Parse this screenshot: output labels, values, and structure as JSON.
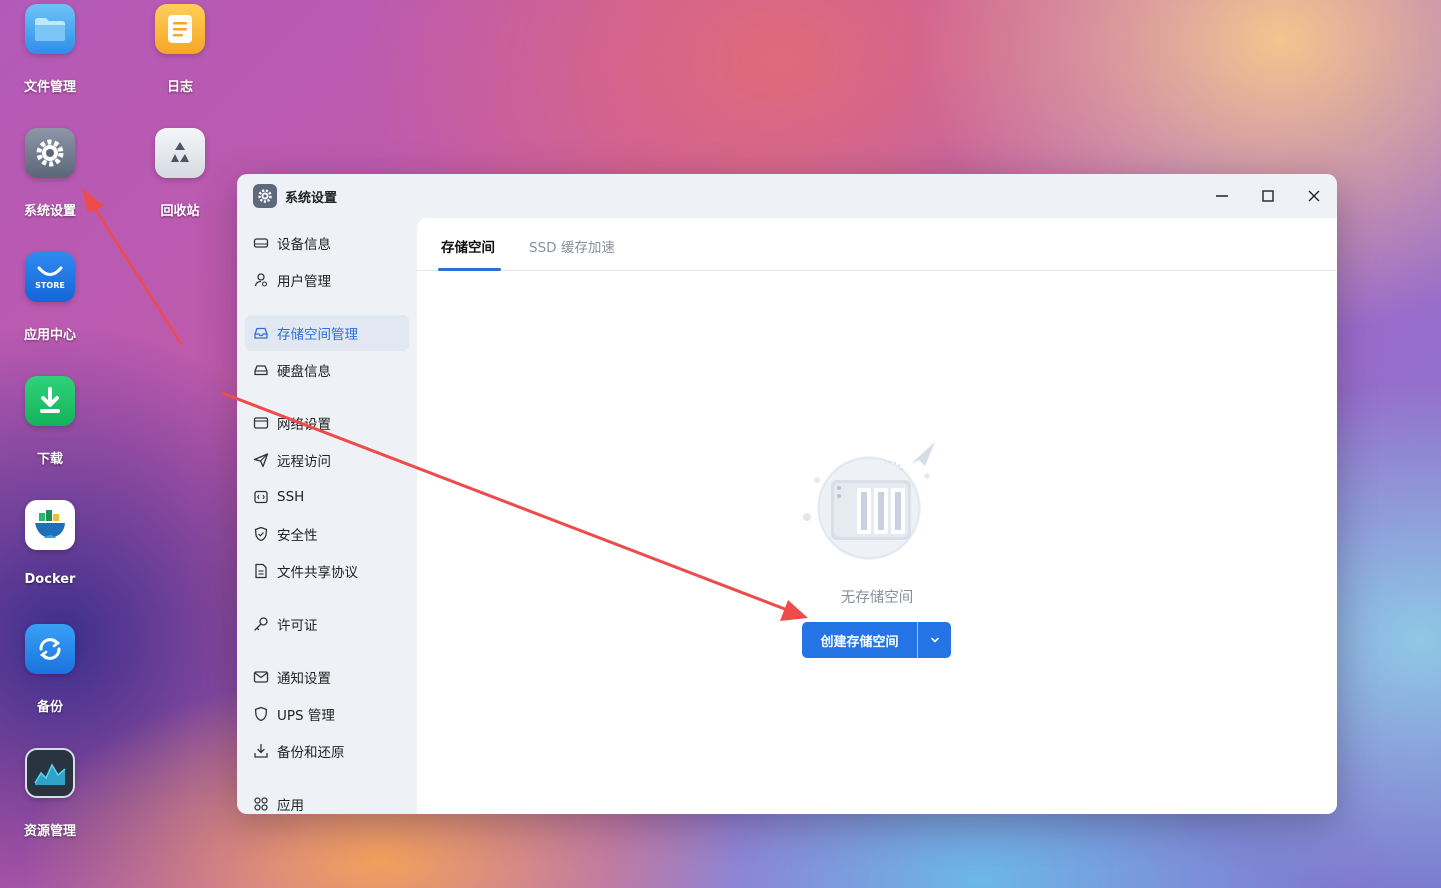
{
  "desktop": {
    "icons": [
      {
        "label": "文件管理"
      },
      {
        "label": "日志"
      },
      {
        "label": "系统设置"
      },
      {
        "label": "回收站"
      },
      {
        "label": "应用中心",
        "badge": "STORE"
      },
      {
        "label": "下载"
      },
      {
        "label": "Docker"
      },
      {
        "label": "备份"
      },
      {
        "label": "资源管理"
      }
    ]
  },
  "window": {
    "title": "系统设置",
    "controls": [
      "minimize-icon",
      "maximize-icon",
      "close-icon"
    ]
  },
  "sidebar": {
    "items": [
      {
        "label": "设备信息",
        "icon": "device-icon"
      },
      {
        "label": "用户管理",
        "icon": "user-icon"
      },
      {
        "label": "存储空间管理",
        "icon": "storage-icon",
        "active": true
      },
      {
        "label": "硬盘信息",
        "icon": "disk-icon"
      },
      {
        "label": "网络设置",
        "icon": "network-icon"
      },
      {
        "label": "远程访问",
        "icon": "send-icon"
      },
      {
        "label": "SSH",
        "icon": "ssh-icon"
      },
      {
        "label": "安全性",
        "icon": "shield-check-icon"
      },
      {
        "label": "文件共享协议",
        "icon": "document-icon"
      },
      {
        "label": "许可证",
        "icon": "key-icon"
      },
      {
        "label": "通知设置",
        "icon": "mail-icon"
      },
      {
        "label": "UPS 管理",
        "icon": "shield-icon"
      },
      {
        "label": "备份和还原",
        "icon": "download-tray-icon"
      },
      {
        "label": "应用",
        "icon": "apps-icon"
      }
    ]
  },
  "main": {
    "tabs": [
      {
        "label": "存储空间",
        "active": true
      },
      {
        "label": "SSD 缓存加速",
        "active": false
      }
    ],
    "empty_text": "无存储空间",
    "create_button": "创建存储空间"
  },
  "colors": {
    "accent": "#2474e5",
    "annotation_arrow": "#ee4b4b"
  }
}
